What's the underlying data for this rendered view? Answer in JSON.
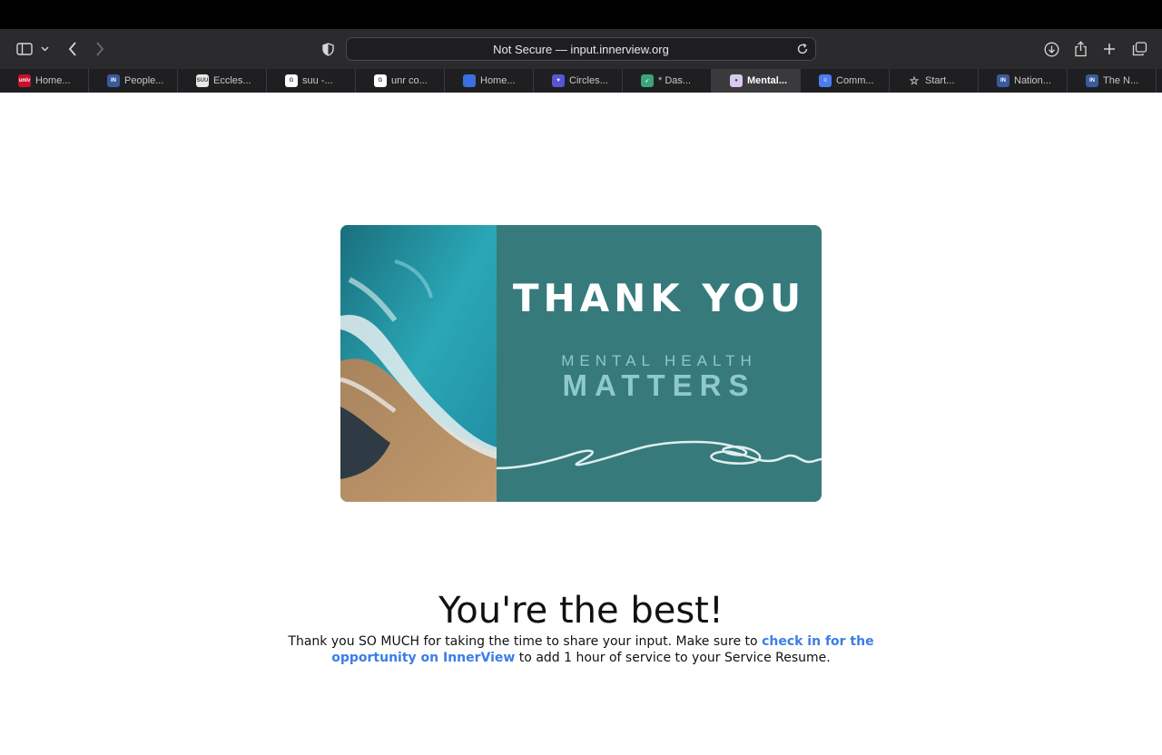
{
  "browser": {
    "address": "Not Secure — input.innerview.org",
    "tabs": [
      {
        "label": "Home...",
        "icon": "unlv-favicon",
        "color": "#c8102e",
        "mark": "unlv"
      },
      {
        "label": "People...",
        "icon": "innerview-favicon",
        "color": "#3a5a9c",
        "mark": "IN"
      },
      {
        "label": "Eccles...",
        "icon": "suu-favicon",
        "color": "#e8e8e8",
        "mark": "SUU"
      },
      {
        "label": "suu -...",
        "icon": "google-favicon",
        "color": "#ffffff",
        "mark": "G"
      },
      {
        "label": "unr co...",
        "icon": "google-favicon",
        "color": "#ffffff",
        "mark": "G"
      },
      {
        "label": "Home...",
        "icon": "circle-favicon",
        "color": "#3b6fe0",
        "mark": ""
      },
      {
        "label": "Circles...",
        "icon": "heart-favicon",
        "color": "#5a55d6",
        "mark": "♥"
      },
      {
        "label": "* Das...",
        "icon": "shield-favicon",
        "color": "#3aa57a",
        "mark": "✓"
      },
      {
        "label": "Mental...",
        "icon": "mentalhealth-favicon",
        "color": "#d9c8f0",
        "mark": "●"
      },
      {
        "label": "Comm...",
        "icon": "docs-favicon",
        "color": "#4a7ef0",
        "mark": "≡"
      },
      {
        "label": "Start...",
        "icon": "star-favicon",
        "color": "transparent",
        "mark": "☆"
      },
      {
        "label": "Nation...",
        "icon": "innerview-favicon",
        "color": "#3a5a9c",
        "mark": "IN"
      },
      {
        "label": "The N...",
        "icon": "innerview-favicon",
        "color": "#3a5a9c",
        "mark": "IN"
      }
    ]
  },
  "card": {
    "thank_you": "THANK YOU",
    "mental_health": "MENTAL HEALTH",
    "matters": "MATTERS"
  },
  "page": {
    "headline": "You're the best!",
    "message_start": "Thank you SO MUCH for taking the time to share your input. Make sure to ",
    "message_link": "check in for the opportunity on InnerView",
    "message_end": " to add 1 hour of service to your Service Resume."
  }
}
